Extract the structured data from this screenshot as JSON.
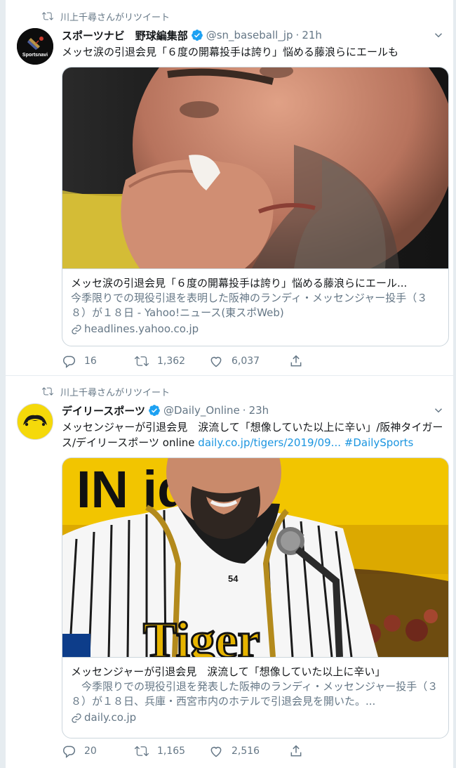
{
  "tweets": [
    {
      "retweeted_by": "川上千尋さんがリツイート",
      "display_name": "スポーツナビ　野球編集部",
      "handle": "@sn_baseball_jp",
      "separator": "·",
      "time": "21h",
      "text": "メッセ涙の引退会見「６度の開幕投手は誇り」悩める藤浪らにエールも",
      "avatar_label": "Sportsnavi",
      "card": {
        "title": "メッセ涙の引退会見「６度の開幕投手は誇り」悩める藤浪らにエール...",
        "description": "今季限りでの現役引退を表明した阪神のランディ・メッセンジャー投手（３８）が１８日 - Yahoo!ニュース(東スポWeb)",
        "domain": "headlines.yahoo.co.jp"
      },
      "replies": "16",
      "retweets": "1,362",
      "likes": "6,037"
    },
    {
      "retweeted_by": "川上千尋さんがリツイート",
      "display_name": "デイリースポーツ",
      "handle": "@Daily_Online",
      "separator": "·",
      "time": "23h",
      "text_plain": "メッセンジャーが引退会見　涙流して「想像していた以上に辛い」/阪神タイガース/デイリースポーツ online ",
      "text_link": "daily.co.jp/tigers/2019/09...",
      "text_hashtag": "#DailySports",
      "image_banner_text": "IN  iger",
      "image_jersey_text": "Tiger",
      "image_number": "54",
      "card": {
        "title": "メッセンジャーが引退会見　涙流して「想像していた以上に辛い」",
        "description": "　今季限りでの現役引退を発表した阪神のランディ・メッセンジャー投手（３８）が１８日、兵庫・西宮市内のホテルで引退会見を開いた。...",
        "domain": "daily.co.jp"
      },
      "replies": "20",
      "retweets": "1,165",
      "likes": "2,516"
    }
  ],
  "colors": {
    "secondary_text": "#657786",
    "link": "#1b95e0",
    "verified": "#1da1f2",
    "border": "#ccd6dd",
    "daily_avatar_bg": "#f5d90a",
    "tigers_yellow": "#f2c500"
  },
  "icons": [
    "retweet-icon",
    "verified-icon",
    "chevron-down-icon",
    "link-icon",
    "reply-icon",
    "heart-icon",
    "share-icon"
  ]
}
